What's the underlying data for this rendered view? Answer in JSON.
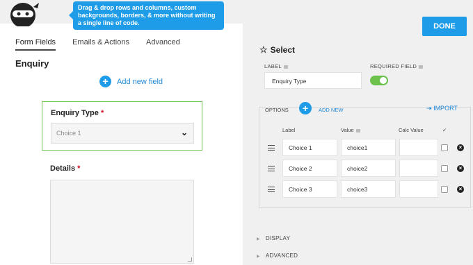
{
  "tooltip": {
    "text": "Drag & drop rows and columns, custom backgrounds, borders, & more without writing a single line of code."
  },
  "tabs": [
    {
      "label": "Form Fields"
    },
    {
      "label": "Emails & Actions"
    },
    {
      "label": "Advanced"
    }
  ],
  "form": {
    "title": "Enquiry",
    "add_field_label": "Add new field",
    "enquiry_field": {
      "label": "Enquiry Type",
      "required_mark": "*",
      "selected": "Choice 1"
    },
    "details_field": {
      "label": "Details",
      "required_mark": "*"
    }
  },
  "settings": {
    "done_label": "DONE",
    "title": "Select",
    "label_caption": "LABEL",
    "label_value": "Enquiry Type",
    "required_caption": "REQUIRED FIELD",
    "required_on": true,
    "options_caption": "OPTIONS",
    "add_new_label": "ADD NEW",
    "import_label": "IMPORT",
    "columns": {
      "label": "Label",
      "value": "Value",
      "calc": "Calc Value",
      "check": "✓"
    },
    "options": [
      {
        "label": "Choice 1",
        "value": "choice1",
        "calc": ""
      },
      {
        "label": "Choice 2",
        "value": "choice2",
        "calc": ""
      },
      {
        "label": "Choice 3",
        "value": "choice3",
        "calc": ""
      }
    ],
    "display_label": "DISPLAY",
    "advanced_label": "ADVANCED"
  },
  "colors": {
    "accent": "#1e9ce8",
    "toggle_on": "#6cc24a",
    "required": "#d0021b"
  }
}
